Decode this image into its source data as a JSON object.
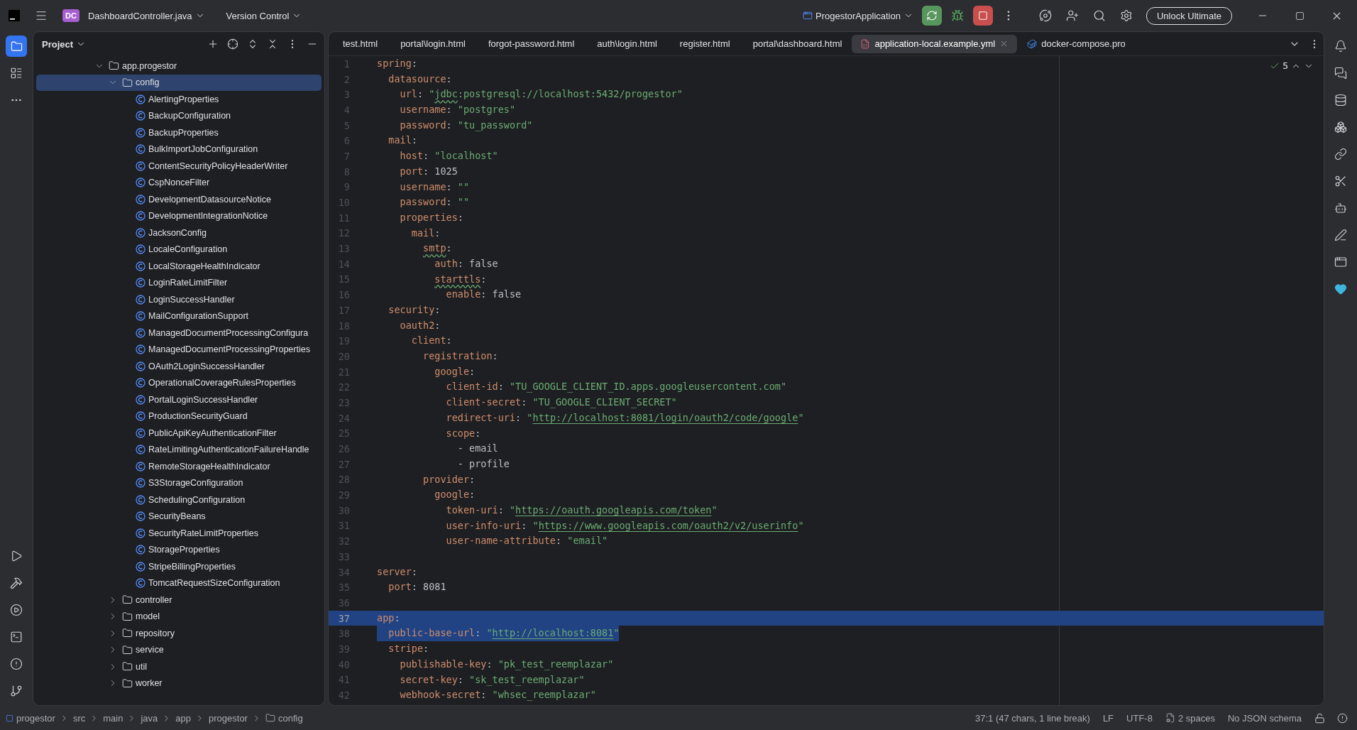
{
  "title_bar": {
    "project_badge": "DC",
    "project_file": "DashboardController.java",
    "vcs_menu": "Version Control",
    "run_config": "ProgestorApplication",
    "unlock_button": "Unlock Ultimate"
  },
  "project_panel": {
    "title": "Project",
    "tree": [
      {
        "label": "app.progestor",
        "kind": "package",
        "expanded": true,
        "selected": false,
        "children": [
          {
            "label": "config",
            "kind": "package",
            "expanded": true,
            "selected": true,
            "children": [
              {
                "label": "AlertingProperties",
                "kind": "class",
                "selected": false
              },
              {
                "label": "BackupConfiguration",
                "kind": "class",
                "selected": false
              },
              {
                "label": "BackupProperties",
                "kind": "class",
                "selected": false
              },
              {
                "label": "BulkImportJobConfiguration",
                "kind": "class",
                "selected": false
              },
              {
                "label": "ContentSecurityPolicyHeaderWriter",
                "kind": "class",
                "selected": false
              },
              {
                "label": "CspNonceFilter",
                "kind": "class",
                "selected": false
              },
              {
                "label": "DevelopmentDatasourceNotice",
                "kind": "class",
                "selected": false
              },
              {
                "label": "DevelopmentIntegrationNotice",
                "kind": "class",
                "selected": false
              },
              {
                "label": "JacksonConfig",
                "kind": "class",
                "selected": false
              },
              {
                "label": "LocaleConfiguration",
                "kind": "class",
                "selected": false
              },
              {
                "label": "LocalStorageHealthIndicator",
                "kind": "class",
                "selected": false
              },
              {
                "label": "LoginRateLimitFilter",
                "kind": "class",
                "selected": false
              },
              {
                "label": "LoginSuccessHandler",
                "kind": "class",
                "selected": false
              },
              {
                "label": "MailConfigurationSupport",
                "kind": "class",
                "selected": false
              },
              {
                "label": "ManagedDocumentProcessingConfigura",
                "kind": "class",
                "selected": false
              },
              {
                "label": "ManagedDocumentProcessingProperties",
                "kind": "class",
                "selected": false
              },
              {
                "label": "OAuth2LoginSuccessHandler",
                "kind": "class",
                "selected": false
              },
              {
                "label": "OperationalCoverageRulesProperties",
                "kind": "class",
                "selected": false
              },
              {
                "label": "PortalLoginSuccessHandler",
                "kind": "class",
                "selected": false
              },
              {
                "label": "ProductionSecurityGuard",
                "kind": "class",
                "selected": false
              },
              {
                "label": "PublicApiKeyAuthenticationFilter",
                "kind": "class",
                "selected": false
              },
              {
                "label": "RateLimitingAuthenticationFailureHandle",
                "kind": "class",
                "selected": false
              },
              {
                "label": "RemoteStorageHealthIndicator",
                "kind": "class",
                "selected": false
              },
              {
                "label": "S3StorageConfiguration",
                "kind": "class",
                "selected": false
              },
              {
                "label": "SchedulingConfiguration",
                "kind": "class",
                "selected": false
              },
              {
                "label": "SecurityBeans",
                "kind": "class",
                "selected": false
              },
              {
                "label": "SecurityRateLimitProperties",
                "kind": "class",
                "selected": false
              },
              {
                "label": "StorageProperties",
                "kind": "class",
                "selected": false
              },
              {
                "label": "StripeBillingProperties",
                "kind": "class",
                "selected": false
              },
              {
                "label": "TomcatRequestSizeConfiguration",
                "kind": "class",
                "selected": false
              }
            ]
          },
          {
            "label": "controller",
            "kind": "package",
            "expanded": false,
            "selected": false
          },
          {
            "label": "model",
            "kind": "package",
            "expanded": false,
            "selected": false
          },
          {
            "label": "repository",
            "kind": "package",
            "expanded": false,
            "selected": false
          },
          {
            "label": "service",
            "kind": "package",
            "expanded": false,
            "selected": false
          },
          {
            "label": "util",
            "kind": "package",
            "expanded": false,
            "selected": false
          },
          {
            "label": "worker",
            "kind": "package",
            "expanded": false,
            "selected": false
          }
        ]
      }
    ]
  },
  "editor": {
    "tabs": [
      {
        "label": "test.html",
        "kind": "html",
        "selected": false
      },
      {
        "label": "portal\\login.html",
        "kind": "html",
        "selected": false
      },
      {
        "label": "forgot-password.html",
        "kind": "html",
        "selected": false
      },
      {
        "label": "auth\\login.html",
        "kind": "html",
        "selected": false
      },
      {
        "label": "register.html",
        "kind": "html",
        "selected": false
      },
      {
        "label": "portal\\dashboard.html",
        "kind": "html",
        "selected": false
      },
      {
        "label": "application-local.example.yml",
        "kind": "yaml",
        "selected": true
      },
      {
        "label": "docker-compose.pro",
        "kind": "docker",
        "selected": false
      }
    ],
    "inspections": "5",
    "lines": [
      {
        "number": "1",
        "selected": false,
        "tokens": [
          {
            "kind": "key",
            "text": "spring"
          },
          {
            "kind": "p",
            "text": ":"
          }
        ]
      },
      {
        "number": "2",
        "selected": false,
        "tokens": [
          {
            "kind": "key",
            "text": "  datasource"
          },
          {
            "kind": "p",
            "text": ":"
          }
        ]
      },
      {
        "number": "3",
        "selected": false,
        "tokens": [
          {
            "kind": "key",
            "text": "    url"
          },
          {
            "kind": "p",
            "text": ": "
          },
          {
            "kind": "str",
            "text": "\""
          },
          {
            "kind": "stypo",
            "text": "jdbc"
          },
          {
            "kind": "str",
            "text": ":postgresql://localhost:5432/progestor\""
          }
        ]
      },
      {
        "number": "4",
        "selected": false,
        "tokens": [
          {
            "kind": "key",
            "text": "    username"
          },
          {
            "kind": "p",
            "text": ": "
          },
          {
            "kind": "str",
            "text": "\"postgres\""
          }
        ]
      },
      {
        "number": "5",
        "selected": false,
        "tokens": [
          {
            "kind": "key",
            "text": "    password"
          },
          {
            "kind": "p",
            "text": ": "
          },
          {
            "kind": "str",
            "text": "\"tu_password\""
          }
        ]
      },
      {
        "number": "6",
        "selected": false,
        "tokens": [
          {
            "kind": "key",
            "text": "  mail"
          },
          {
            "kind": "p",
            "text": ":"
          }
        ]
      },
      {
        "number": "7",
        "selected": false,
        "tokens": [
          {
            "kind": "key",
            "text": "    host"
          },
          {
            "kind": "p",
            "text": ": "
          },
          {
            "kind": "str",
            "text": "\"localhost\""
          }
        ]
      },
      {
        "number": "8",
        "selected": false,
        "tokens": [
          {
            "kind": "key",
            "text": "    port"
          },
          {
            "kind": "p",
            "text": ": "
          },
          {
            "kind": "val",
            "text": "1025"
          }
        ]
      },
      {
        "number": "9",
        "selected": false,
        "tokens": [
          {
            "kind": "key",
            "text": "    username"
          },
          {
            "kind": "p",
            "text": ": "
          },
          {
            "kind": "str",
            "text": "\"\""
          }
        ]
      },
      {
        "number": "10",
        "selected": false,
        "tokens": [
          {
            "kind": "key",
            "text": "    password"
          },
          {
            "kind": "p",
            "text": ": "
          },
          {
            "kind": "str",
            "text": "\"\""
          }
        ]
      },
      {
        "number": "11",
        "selected": false,
        "tokens": [
          {
            "kind": "key",
            "text": "    properties"
          },
          {
            "kind": "p",
            "text": ":"
          }
        ]
      },
      {
        "number": "12",
        "selected": false,
        "tokens": [
          {
            "kind": "key",
            "text": "      mail"
          },
          {
            "kind": "p",
            "text": ":"
          }
        ]
      },
      {
        "number": "13",
        "selected": false,
        "tokens": [
          {
            "kind": "typo",
            "text": "        smtp"
          },
          {
            "kind": "p",
            "text": ":"
          }
        ]
      },
      {
        "number": "14",
        "selected": false,
        "tokens": [
          {
            "kind": "key",
            "text": "          auth"
          },
          {
            "kind": "p",
            "text": ": "
          },
          {
            "kind": "val",
            "text": "false"
          }
        ]
      },
      {
        "number": "15",
        "selected": false,
        "tokens": [
          {
            "kind": "typo",
            "text": "          starttls"
          },
          {
            "kind": "p",
            "text": ":"
          }
        ]
      },
      {
        "number": "16",
        "selected": false,
        "tokens": [
          {
            "kind": "key",
            "text": "            enable"
          },
          {
            "kind": "p",
            "text": ": "
          },
          {
            "kind": "val",
            "text": "false"
          }
        ]
      },
      {
        "number": "17",
        "selected": false,
        "tokens": [
          {
            "kind": "key",
            "text": "  security"
          },
          {
            "kind": "p",
            "text": ":"
          }
        ]
      },
      {
        "number": "18",
        "selected": false,
        "tokens": [
          {
            "kind": "key",
            "text": "    oauth2"
          },
          {
            "kind": "p",
            "text": ":"
          }
        ]
      },
      {
        "number": "19",
        "selected": false,
        "tokens": [
          {
            "kind": "key",
            "text": "      client"
          },
          {
            "kind": "p",
            "text": ":"
          }
        ]
      },
      {
        "number": "20",
        "selected": false,
        "tokens": [
          {
            "kind": "key",
            "text": "        registration"
          },
          {
            "kind": "p",
            "text": ":"
          }
        ]
      },
      {
        "number": "21",
        "selected": false,
        "tokens": [
          {
            "kind": "key",
            "text": "          google"
          },
          {
            "kind": "p",
            "text": ":"
          }
        ]
      },
      {
        "number": "22",
        "selected": false,
        "tokens": [
          {
            "kind": "key",
            "text": "            client-id"
          },
          {
            "kind": "p",
            "text": ": "
          },
          {
            "kind": "str",
            "text": "\"TU_GOOGLE_CLIENT_ID.apps.googleusercontent.com\""
          }
        ]
      },
      {
        "number": "23",
        "selected": false,
        "tokens": [
          {
            "kind": "key",
            "text": "            client-secret"
          },
          {
            "kind": "p",
            "text": ": "
          },
          {
            "kind": "str",
            "text": "\"TU_GOOGLE_CLIENT_SECRET\""
          }
        ]
      },
      {
        "number": "24",
        "selected": false,
        "tokens": [
          {
            "kind": "key",
            "text": "            redirect-uri"
          },
          {
            "kind": "p",
            "text": ": "
          },
          {
            "kind": "str",
            "text": "\""
          },
          {
            "kind": "link",
            "text": "http://localhost:8081/login/oauth2/code/google"
          },
          {
            "kind": "str",
            "text": "\""
          }
        ]
      },
      {
        "number": "25",
        "selected": false,
        "tokens": [
          {
            "kind": "key",
            "text": "            scope"
          },
          {
            "kind": "p",
            "text": ":"
          }
        ]
      },
      {
        "number": "26",
        "selected": false,
        "tokens": [
          {
            "kind": "val",
            "text": "              - email"
          }
        ]
      },
      {
        "number": "27",
        "selected": false,
        "tokens": [
          {
            "kind": "val",
            "text": "              - profile"
          }
        ]
      },
      {
        "number": "28",
        "selected": false,
        "tokens": [
          {
            "kind": "key",
            "text": "        provider"
          },
          {
            "kind": "p",
            "text": ":"
          }
        ]
      },
      {
        "number": "29",
        "selected": false,
        "tokens": [
          {
            "kind": "key",
            "text": "          google"
          },
          {
            "kind": "p",
            "text": ":"
          }
        ]
      },
      {
        "number": "30",
        "selected": false,
        "tokens": [
          {
            "kind": "key",
            "text": "            token-uri"
          },
          {
            "kind": "p",
            "text": ": "
          },
          {
            "kind": "str",
            "text": "\""
          },
          {
            "kind": "link",
            "text": "https://oauth.googleapis.com/token"
          },
          {
            "kind": "str",
            "text": "\""
          }
        ]
      },
      {
        "number": "31",
        "selected": false,
        "tokens": [
          {
            "kind": "key",
            "text": "            user-info-uri"
          },
          {
            "kind": "p",
            "text": ": "
          },
          {
            "kind": "str",
            "text": "\""
          },
          {
            "kind": "link",
            "text": "https://www.googleapis.com/oauth2/v2/userinfo"
          },
          {
            "kind": "str",
            "text": "\""
          }
        ]
      },
      {
        "number": "32",
        "selected": false,
        "tokens": [
          {
            "kind": "key",
            "text": "            user-name-attribute"
          },
          {
            "kind": "p",
            "text": ": "
          },
          {
            "kind": "str",
            "text": "\"email\""
          }
        ]
      },
      {
        "number": "33",
        "selected": false
      },
      {
        "number": "34",
        "selected": false,
        "tokens": [
          {
            "kind": "key",
            "text": "server"
          },
          {
            "kind": "p",
            "text": ":"
          }
        ]
      },
      {
        "number": "35",
        "selected": false,
        "tokens": [
          {
            "kind": "key",
            "text": "  port"
          },
          {
            "kind": "p",
            "text": ": "
          },
          {
            "kind": "val",
            "text": "8081"
          }
        ]
      },
      {
        "number": "36",
        "selected": false
      },
      {
        "number": "37",
        "selected": true,
        "tokens": [
          {
            "kind": "key",
            "text": "app"
          },
          {
            "kind": "p",
            "text": ":"
          }
        ]
      },
      {
        "number": "38",
        "selected": true,
        "tokens": [
          {
            "kind": "key",
            "text": "  public-base-url"
          },
          {
            "kind": "p",
            "text": ": "
          },
          {
            "kind": "str",
            "text": "\""
          },
          {
            "kind": "link",
            "text": "http://localhost:8081"
          },
          {
            "kind": "str",
            "text": "\""
          }
        ]
      },
      {
        "number": "39",
        "selected": false,
        "tokens": [
          {
            "kind": "key",
            "text": "  stripe"
          },
          {
            "kind": "p",
            "text": ":"
          }
        ]
      },
      {
        "number": "40",
        "selected": false,
        "tokens": [
          {
            "kind": "key",
            "text": "    publishable-key"
          },
          {
            "kind": "p",
            "text": ": "
          },
          {
            "kind": "str",
            "text": "\"pk_test_reemplazar\""
          }
        ]
      },
      {
        "number": "41",
        "selected": false,
        "tokens": [
          {
            "kind": "key",
            "text": "    secret-key"
          },
          {
            "kind": "p",
            "text": ": "
          },
          {
            "kind": "str",
            "text": "\"sk_test_reemplazar\""
          }
        ]
      },
      {
        "number": "42",
        "selected": false,
        "tokens": [
          {
            "kind": "key",
            "text": "    webhook-secret"
          },
          {
            "kind": "p",
            "text": ": "
          },
          {
            "kind": "str",
            "text": "\"whsec_reemplazar\""
          }
        ]
      }
    ]
  },
  "status_bar": {
    "breadcrumbs": [
      {
        "label": "progestor",
        "kind": "module"
      },
      {
        "label": "src",
        "kind": "dir"
      },
      {
        "label": "main",
        "kind": "dir"
      },
      {
        "label": "java",
        "kind": "dir"
      },
      {
        "label": "app",
        "kind": "dir"
      },
      {
        "label": "progestor",
        "kind": "dir"
      },
      {
        "label": "config",
        "kind": "package"
      }
    ],
    "position": "37:1 (47 chars, 1 line break)",
    "line_separator": "LF",
    "encoding": "UTF-8",
    "indent": "2 spaces",
    "schema": "No JSON schema"
  }
}
